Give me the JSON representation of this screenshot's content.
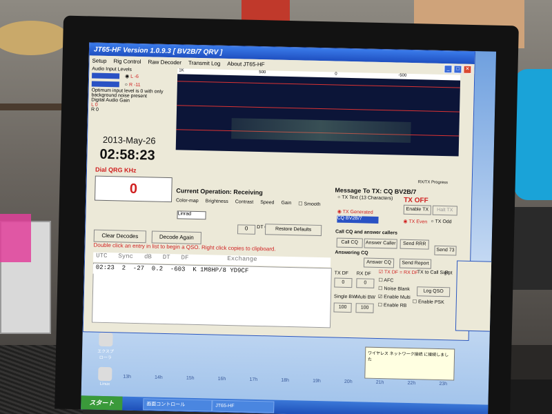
{
  "app": {
    "title": "JT65-HF Version 1.0.9.3 [ BV2B/7 QRV ]",
    "menu": [
      "Setup",
      "Rig Control",
      "Raw Decoder",
      "Transmit Log",
      "About JT65-HF"
    ]
  },
  "levels": {
    "label": "Audio Input Levels",
    "left": "L -6",
    "right": "R -11",
    "note": "Optimum input level is 0 with only background noise present",
    "gain_label": "Digital Audio Gain",
    "gain_l": "L 0",
    "gain_r": "R 0"
  },
  "clock": {
    "date": "2013-May-26",
    "time": "02:58:23"
  },
  "dial": {
    "label": "Dial QRG KHz",
    "value": "0"
  },
  "waterfall": {
    "scale": [
      "1K",
      "500",
      "0",
      "-500"
    ]
  },
  "operation": {
    "current": "Current Operation:  Receiving",
    "colormap_label": "Color-map",
    "brightness_label": "Brightness",
    "contrast_label": "Contrast",
    "speed_label": "Speed",
    "gain_label": "Gain",
    "smooth_label": "Smooth",
    "colormap_value": "Linrad",
    "df_offset_label": "DT Offset",
    "df_offset_value": "0",
    "restore_label": "Restore Defaults"
  },
  "actions": {
    "clear": "Clear Decodes",
    "decode_again": "Decode Again"
  },
  "decodes": {
    "hint": "Double click an entry in list to begin a QSO.  Right click copies to clipboard.",
    "headers": [
      "UTC",
      "Sync",
      "dB",
      "DT",
      "DF",
      "Exchange"
    ],
    "rows": [
      {
        "utc": "02:23",
        "sync": "2",
        "db": "-27",
        "dt": "0.2",
        "df": "-603",
        "mode": "K",
        "exchange": "1M8HP/8 YD9CF"
      }
    ]
  },
  "tx": {
    "message_title": "Message To TX: CQ BV2B/7",
    "tx_off": "TX OFF",
    "tx_text_label": "TX Text (13 Characters)",
    "enable_tx": "Enable TX",
    "halt_tx": "Halt TX",
    "tx_generated": "TX Generated",
    "generated_value": "CQ BV2B/7",
    "tx_even": "TX Even",
    "tx_odd": "TX Odd",
    "call_cq_label": "Call CQ and answer callers",
    "call_cq": "Call CQ",
    "answer_caller": "Answer Caller",
    "send_rrr": "Send RRR",
    "answering_label": "Answering CQ",
    "send_73": "Send 73",
    "answer_cq": "Answer CQ",
    "send_report": "Send Report",
    "tx_df_label": "TX DF",
    "rx_df_label": "RX DF",
    "tx_df_value": "0",
    "rx_df_value": "0",
    "tx_df_rx_df": "TX DF = RX DF",
    "afc": "AFC",
    "noise_blank": "Noise Blank",
    "enable_multi": "Enable Multi",
    "enable_psk": "Enable PSK",
    "enable_rb": "Enable RB",
    "single_bw_label": "Single BW",
    "multi_bw_label": "Multi BW",
    "single_bw": "100",
    "multi_bw": "100",
    "tx_to_callsign": "TX to Call Sign",
    "rpt": "Rpt",
    "log_qso": "Log QSO",
    "rx_tx_progress": "RX/TX Progress"
  },
  "desktop": {
    "icon1": "エクスプローラ",
    "icon2": "Linux",
    "time_axis": [
      "13h",
      "14h",
      "15h",
      "16h",
      "17h",
      "18h",
      "19h",
      "20h",
      "21h",
      "22h",
      "23h"
    ]
  },
  "taskbar": {
    "start": "スタート",
    "task1": "画面コントロール",
    "task2": "JT65-HF"
  },
  "balloon": {
    "text": "ワイヤレス ネットワーク接続 に接続しました"
  }
}
